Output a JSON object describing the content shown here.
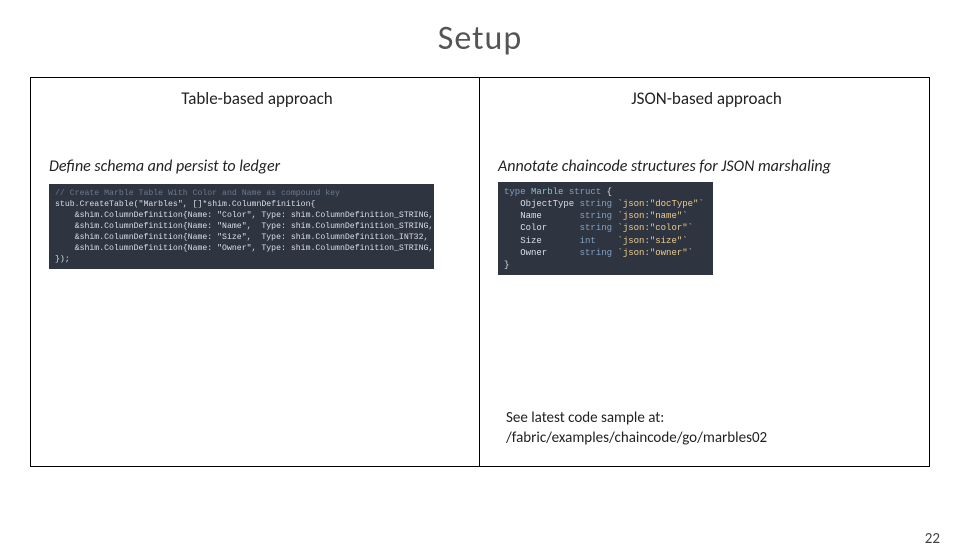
{
  "title": "Setup",
  "left": {
    "header": "Table-based approach",
    "sub": "Define schema and persist to ledger",
    "code_comment": "// Create Marble Table With Color and Name as compound key",
    "code_lines": [
      "stub.CreateTable(\"Marbles\", []*shim.ColumnDefinition{",
      "    &shim.ColumnDefinition{Name: \"Color\", Type: shim.ColumnDefinition_STRING, Key: true},",
      "    &shim.ColumnDefinition{Name: \"Name\",  Type: shim.ColumnDefinition_STRING, Key: true},",
      "    &shim.ColumnDefinition{Name: \"Size\",  Type: shim.ColumnDefinition_INT32,  Key: false},",
      "    &shim.ColumnDefinition{Name: \"Owner\", Type: shim.ColumnDefinition_STRING, Key: false},",
      "});"
    ]
  },
  "right": {
    "header": "JSON-based approach",
    "sub": "Annotate chaincode structures for JSON marshaling",
    "struct_kw": "type",
    "struct_name": "Marble",
    "struct_kw2": "struct",
    "fields": [
      {
        "name": "ObjectType",
        "type": "string",
        "tag": "`json:\"docType\"`"
      },
      {
        "name": "Name",
        "type": "string",
        "tag": "`json:\"name\"`"
      },
      {
        "name": "Color",
        "type": "string",
        "tag": "`json:\"color\"`"
      },
      {
        "name": "Size",
        "type": "int",
        "tag": "`json:\"size\"`"
      },
      {
        "name": "Owner",
        "type": "string",
        "tag": "`json:\"owner\"`"
      }
    ],
    "footer_line1": "See latest code sample at:",
    "footer_line2": "/fabric/examples/chaincode/go/marbles02"
  },
  "page_num": "22"
}
